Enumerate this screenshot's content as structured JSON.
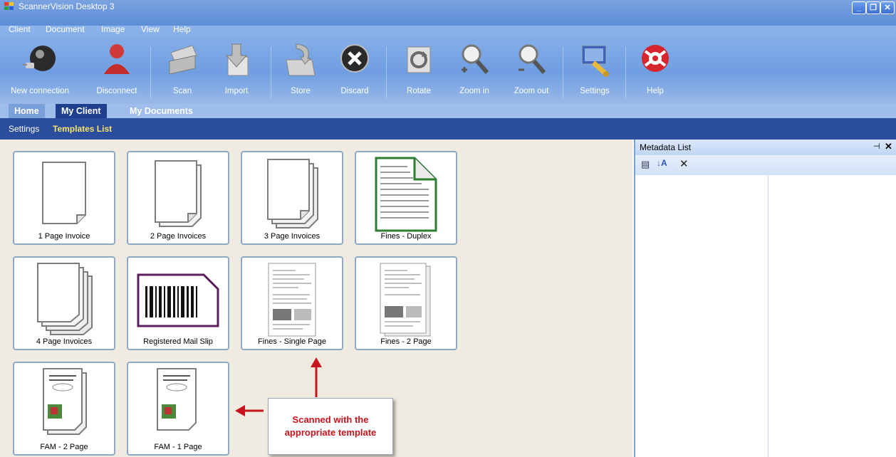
{
  "app": {
    "title": "ScannerVision Desktop 3"
  },
  "menu": [
    "Client",
    "Document",
    "Image",
    "View",
    "Help"
  ],
  "toolbar": [
    {
      "label": "New connection",
      "icon": "globe-plug-icon"
    },
    {
      "label": "Disconnect",
      "icon": "user-icon"
    },
    {
      "label": "Scan",
      "icon": "scanner-icon"
    },
    {
      "label": "Import",
      "icon": "import-arrow-icon"
    },
    {
      "label": "Store",
      "icon": "folder-store-icon"
    },
    {
      "label": "Discard",
      "icon": "discard-x-icon"
    },
    {
      "label": "Rotate",
      "icon": "rotate-icon"
    },
    {
      "label": "Zoom in",
      "icon": "zoom-in-icon"
    },
    {
      "label": "Zoom out",
      "icon": "zoom-out-icon"
    },
    {
      "label": "Settings",
      "icon": "settings-icon"
    },
    {
      "label": "Help",
      "icon": "help-lifebuoy-icon"
    }
  ],
  "tabs": [
    {
      "label": "Home"
    },
    {
      "label": "My Client"
    },
    {
      "label": "My Documents"
    }
  ],
  "subnav": [
    {
      "label": "Settings"
    },
    {
      "label": "Templates List"
    }
  ],
  "templates": [
    {
      "label": "1 Page Invoice"
    },
    {
      "label": "2 Page Invoices"
    },
    {
      "label": "3 Page Invoices"
    },
    {
      "label": "Fines - Duplex"
    },
    {
      "label": "4 Page Invoices"
    },
    {
      "label": "Registered Mail Slip"
    },
    {
      "label": "Fines - Single Page"
    },
    {
      "label": "Fines - 2 Page"
    },
    {
      "label": "FAM - 2 Page"
    },
    {
      "label": "FAM - 1 Page"
    }
  ],
  "metadata": {
    "title": "Metadata List"
  },
  "callout": {
    "line1": "Scanned with the",
    "line2": "appropriate template"
  },
  "colors": {
    "ribbon": "#6f9ee2",
    "active_tab": "#1f3f8f",
    "subnav": "#2a4d9e",
    "highlight": "#f7e36a",
    "callout_text": "#c8141c"
  }
}
